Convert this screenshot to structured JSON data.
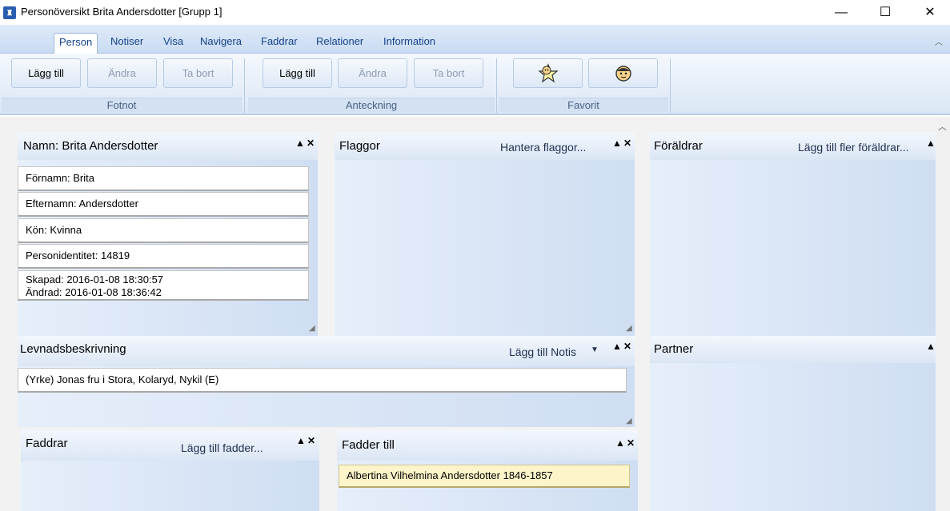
{
  "window": {
    "title": "Personöversikt Brita Andersdotter  [Grupp 1]",
    "minimize": "—",
    "maximize": "☐",
    "close": "✕"
  },
  "ribbon": {
    "tabs": [
      "Person",
      "Notiser",
      "Visa",
      "Navigera",
      "Faddrar",
      "Relationer",
      "Information"
    ],
    "active_tab": "Person",
    "groups": {
      "fotnot": {
        "label": "Fotnot",
        "add": "Lägg till",
        "edit": "Ändra",
        "remove": "Ta bort"
      },
      "anteckning": {
        "label": "Anteckning",
        "add": "Lägg till",
        "edit": "Ändra",
        "remove": "Ta bort"
      },
      "favorit": {
        "label": "Favorit",
        "icons": [
          "star-face-icon",
          "face-icon"
        ]
      }
    }
  },
  "panels": {
    "namn": {
      "title": "Namn: Brita Andersdotter",
      "fields": {
        "fornamn": "Förnamn: Brita",
        "efternamn": "Efternamn: Andersdotter",
        "kon": "Kön: Kvinna",
        "personid": "Personidentitet: 14819",
        "skapad": "Skapad: 2016-01-08 18:30:57",
        "andrad": "Ändrad: 2016-01-08 18:36:42"
      }
    },
    "flaggor": {
      "title": "Flaggor",
      "link": "Hantera flaggor..."
    },
    "foraldrar": {
      "title": "Föräldrar",
      "link": "Lägg till fler föräldrar..."
    },
    "levnad": {
      "title": "Levnadsbeskrivning",
      "link": "Lägg till Notis",
      "entry": "(Yrke) Jonas fru i Stora, Kolaryd, Nykil (E)"
    },
    "partner": {
      "title": "Partner"
    },
    "faddrar": {
      "title": "Faddrar",
      "link": "Lägg till fadder..."
    },
    "fadder_till": {
      "title": "Fadder till",
      "entry": "Albertina Vilhelmina Andersdotter 1846-1857"
    }
  },
  "colors": {
    "accent": "#15428b",
    "panel": "#dbe6f5",
    "highlight": "#fdf5c9"
  }
}
